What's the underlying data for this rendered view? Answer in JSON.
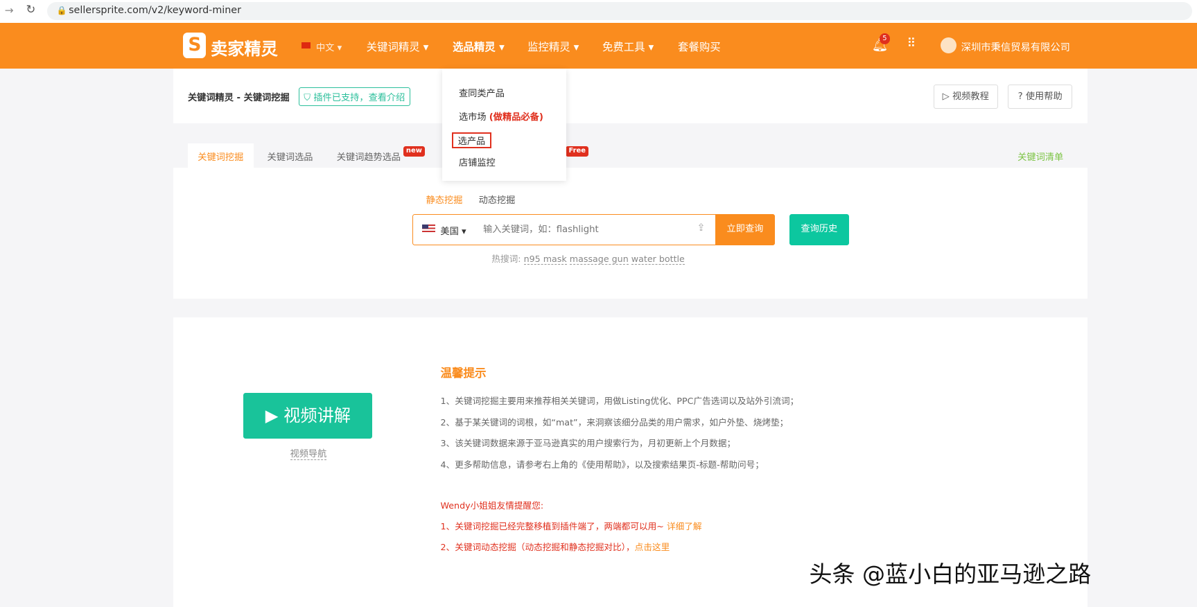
{
  "browser": {
    "url": "sellersprite.com/v2/keyword-miner"
  },
  "nav": {
    "logo": "卖家精灵",
    "lang": "中文",
    "items": [
      "关键词精灵",
      "选品精灵",
      "监控精灵",
      "免费工具",
      "套餐购买"
    ],
    "notif_count": "5",
    "company": "深圳市秉信贸易有限公司"
  },
  "dropdown": {
    "items": [
      "查同类产品",
      "选市场",
      "选产品",
      "店铺监控"
    ],
    "market_note": "(做精品必备)"
  },
  "header": {
    "breadcrumb": "关键词精灵 - 关键词挖掘",
    "plugin_badge": "插件已支持，查看介绍",
    "video_tutorial": "视频教程",
    "help": "使用帮助"
  },
  "tabs": {
    "items": [
      "关键词挖掘",
      "关键词选品",
      "关键词趋势选品"
    ],
    "new_badge": "new",
    "free_badge": "Free",
    "keyword_list": "关键词清单"
  },
  "search": {
    "modes": [
      "静态挖掘",
      "动态挖掘"
    ],
    "country": "美国",
    "placeholder": "输入关键词，如：flashlight",
    "submit": "立即查询",
    "history": "查询历史",
    "hot_label": "热搜词:",
    "hot_words": [
      "n95 mask",
      "massage gun",
      "water bottle"
    ]
  },
  "video": {
    "button": "视频讲解",
    "nav_link": "视频导航"
  },
  "tips": {
    "title": "温馨提示",
    "lines": [
      "1、关键词挖掘主要用来推荐相关关键词，用做Listing优化、PPC广告选词以及站外引流词；",
      "2、基于某关键词的词根，如“mat”，来洞察该细分品类的用户需求，如户外垫、烧烤垫；",
      "3、该关键词数据来源于亚马逊真实的用户搜索行为，月初更新上个月数据；",
      "4、更多帮助信息，请参考右上角的《使用帮助》，以及搜索结果页-标题-帮助问号；"
    ],
    "reminder_title": "Wendy小姐姐友情提醒您:",
    "reminder1": "1、关键词挖掘已经完整移植到插件端了，两端都可以用~",
    "reminder1_link": "详细了解",
    "reminder2": "2、关键词动态挖掘（动态挖掘和静态挖掘对比），",
    "reminder2_link": "点击这里"
  },
  "watermark": "头条 @蓝小白的亚马逊之路"
}
